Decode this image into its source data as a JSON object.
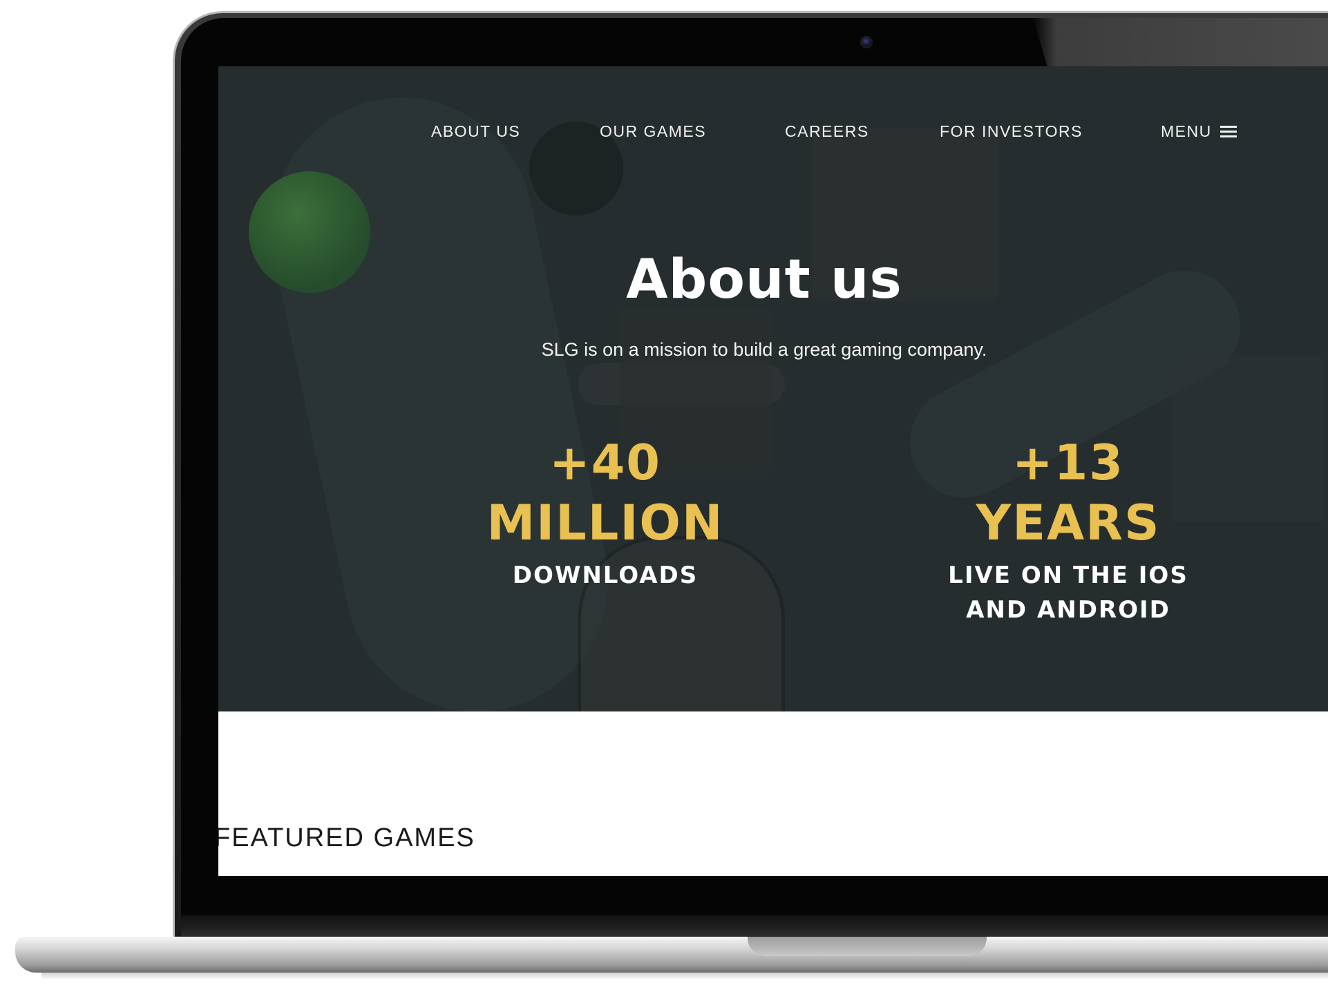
{
  "nav": {
    "about": "ABOUT US",
    "games": "OUR GAMES",
    "careers": "CAREERS",
    "investors": "FOR INVESTORS",
    "menu": "MENU"
  },
  "hero": {
    "title": "About us",
    "subtitle": "SLG is on a mission to build a great gaming company."
  },
  "stats": [
    {
      "number": "+40",
      "unit": "MILLION",
      "label_line1": "DOWNLOADS",
      "label_line2": ""
    },
    {
      "number": "+13",
      "unit": "YEARS",
      "label_line1": "LIVE ON THE IOS",
      "label_line2": "AND ANDROID"
    }
  ],
  "featured": {
    "title": "FEATURED GAMES"
  },
  "colors": {
    "hero_background": "#262d2e",
    "accent_yellow": "#e8c152",
    "text_white": "#ffffff"
  },
  "icons": {
    "menu": "hamburger-icon",
    "camera": "webcam-icon"
  }
}
